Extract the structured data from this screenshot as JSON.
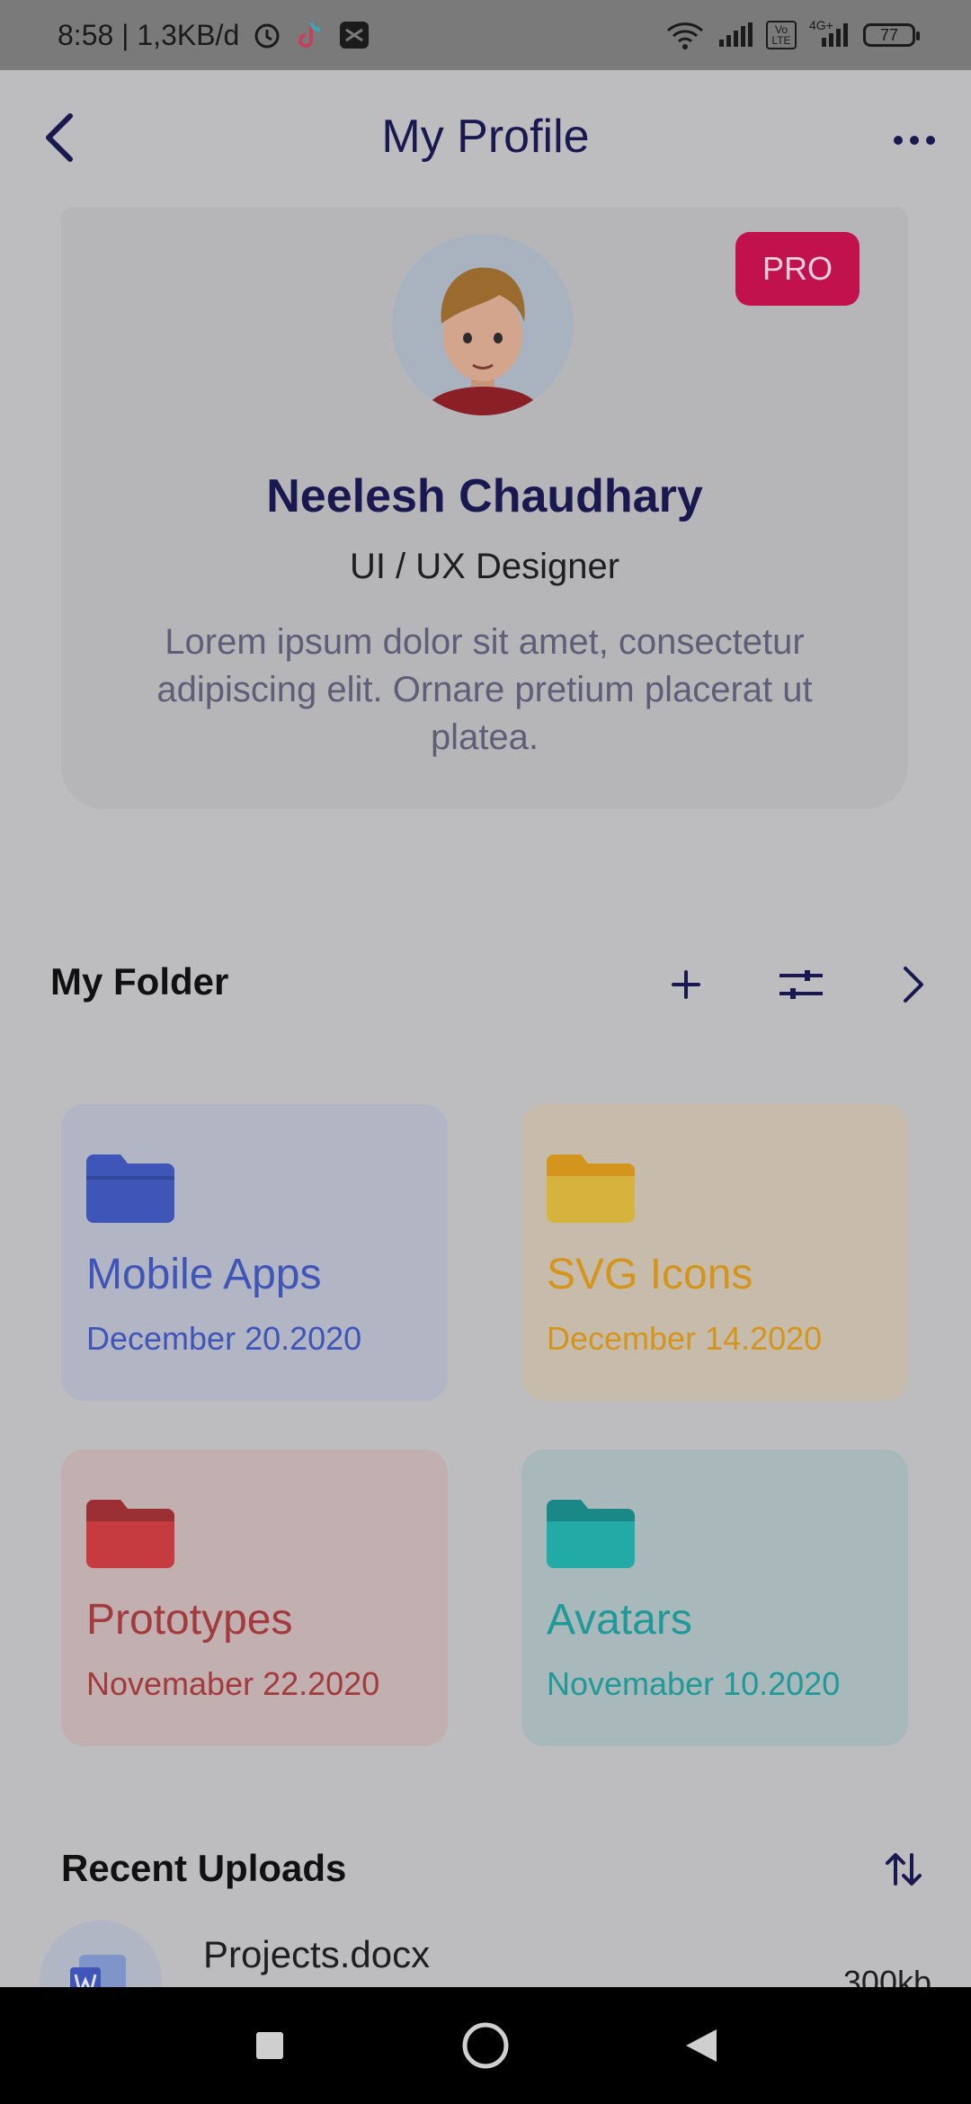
{
  "status_bar": {
    "time_speed": "8:58 | 1,3KB/d",
    "volte": "Vo LTE",
    "network": "4G+",
    "battery": "77"
  },
  "header": {
    "title": "My Profile"
  },
  "profile": {
    "badge": "PRO",
    "name": "Neelesh Chaudhary",
    "role": "UI / UX Designer",
    "bio": "Lorem ipsum dolor sit amet, consectetur adipiscing elit. Ornare pretium placerat ut platea."
  },
  "folders_section": {
    "title": "My Folder",
    "folders": [
      {
        "name": "Mobile Apps",
        "date": "December 20.2020",
        "color": "#3f56b8",
        "bg": "#b2b5c4"
      },
      {
        "name": "SVG Icons",
        "date": "December 14.2020",
        "color": "#d4951c",
        "bg": "#c7bcab"
      },
      {
        "name": "Prototypes",
        "date": "Novemaber 22.2020",
        "color": "#a33a3e",
        "bg": "#c2b0b0"
      },
      {
        "name": "Avatars",
        "date": "Novemaber 10.2020",
        "color": "#1f9a98",
        "bg": "#a9b8bb"
      }
    ]
  },
  "recent_uploads": {
    "title": "Recent Uploads",
    "items": [
      {
        "name": "Projects.docx",
        "size": "300kb"
      }
    ]
  }
}
